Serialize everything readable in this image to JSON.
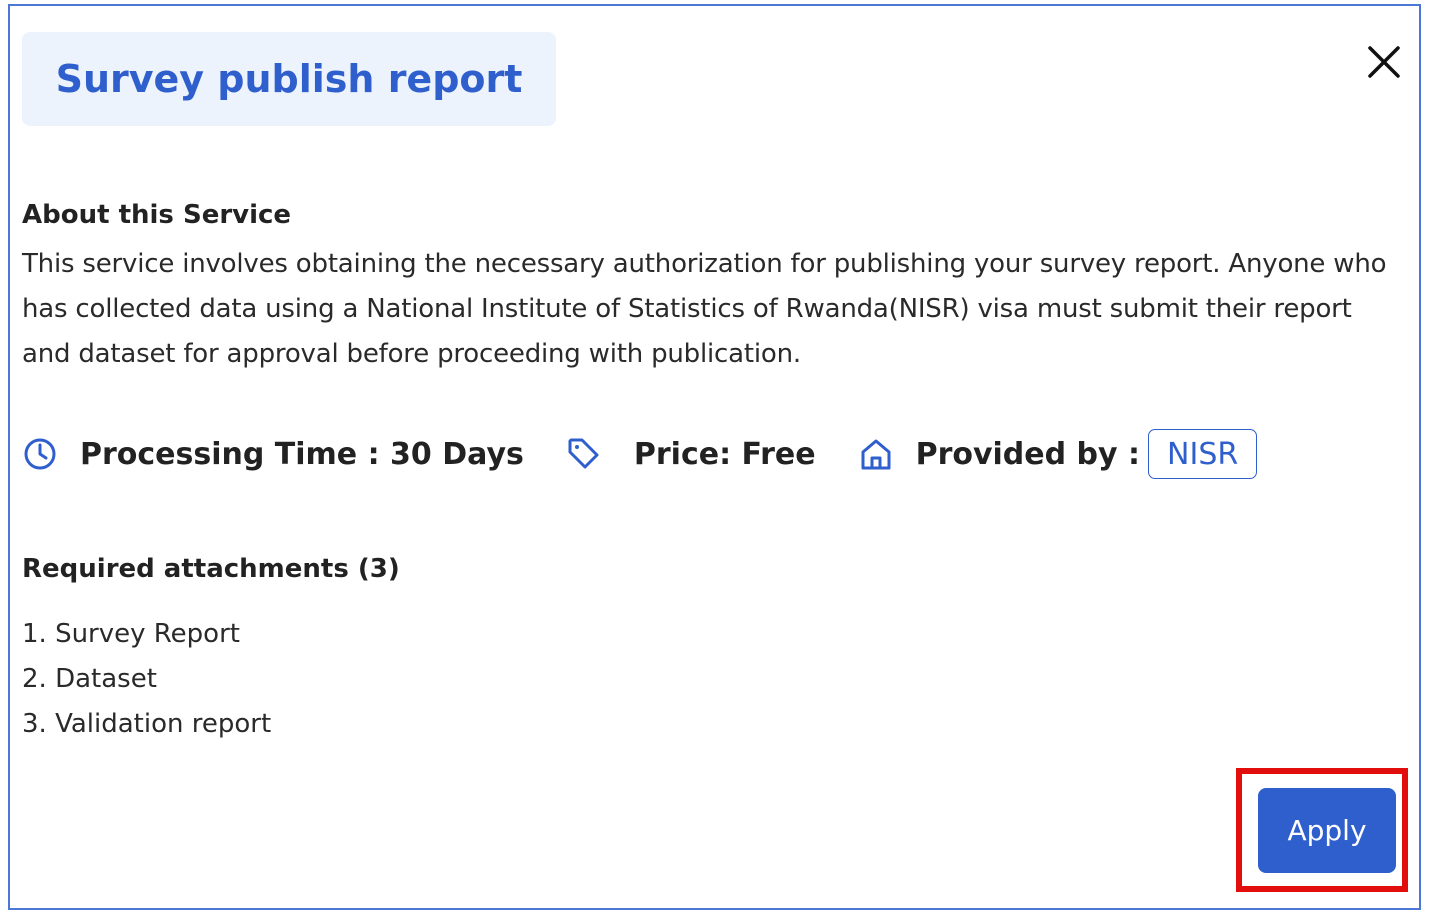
{
  "modal": {
    "title": "Survey publish report",
    "close_icon": "close-icon"
  },
  "about": {
    "heading": "About this Service",
    "text": "This service involves obtaining the necessary authorization for publishing your survey report. Anyone who has collected data using a National Institute of Statistics of Rwanda(NISR) visa must submit their report and dataset for approval before proceeding with publication."
  },
  "meta": {
    "processing_time": "Processing Time : 30 Days",
    "price": "Price: Free",
    "provided_by_label": "Provided by :",
    "provider": "NISR",
    "icons": [
      "clock-icon",
      "tag-icon",
      "home-icon"
    ]
  },
  "attachments": {
    "heading": "Required attachments (3)",
    "items": [
      "1. Survey Report",
      "2. Dataset",
      "3. Validation report"
    ]
  },
  "actions": {
    "apply_label": "Apply"
  },
  "colors": {
    "accent": "#2f5fcc",
    "modal_border": "#4a78d4",
    "title_bg": "#edf3fc",
    "highlight": "#e20d0d"
  }
}
